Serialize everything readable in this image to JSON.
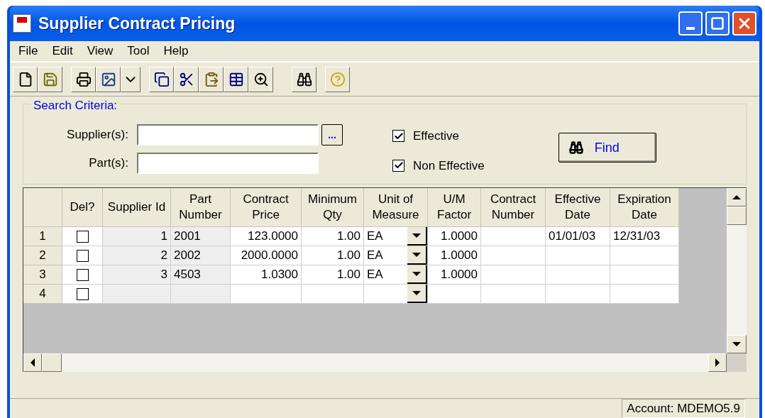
{
  "window": {
    "title": "Supplier Contract Pricing"
  },
  "menu": [
    {
      "label": "File"
    },
    {
      "label": "Edit"
    },
    {
      "label": "View"
    },
    {
      "label": "Tool"
    },
    {
      "label": "Help"
    }
  ],
  "search": {
    "legend": "Search Criteria:",
    "supplier_label": "Supplier(s):",
    "browse": "...",
    "part_label": "Part(s):",
    "checkboxes": [
      {
        "label": "Effective",
        "checked": true
      },
      {
        "label": "Non Effective",
        "checked": true
      }
    ],
    "find_button": "Find"
  },
  "table": {
    "columns": [
      {
        "label": "Del?",
        "kind": "checkbox"
      },
      {
        "label": "Supplier Id",
        "kind": "readonly-number"
      },
      {
        "label": "Part Number",
        "kind": "readonly-text"
      },
      {
        "label": "Contract Price",
        "kind": "number"
      },
      {
        "label": "Minimum Qty",
        "kind": "number"
      },
      {
        "label": "Unit of Measure",
        "kind": "dropdown"
      },
      {
        "label": "U/M Factor",
        "kind": "number"
      },
      {
        "label": "Contract Number",
        "kind": "text"
      },
      {
        "label": "Effective Date",
        "kind": "text"
      },
      {
        "label": "Expiration Date",
        "kind": "text"
      }
    ],
    "rows": [
      {
        "number": "1",
        "del": false,
        "cells": [
          "",
          "1",
          "2001",
          "123.0000",
          "1.00",
          "EA",
          "1.0000",
          "",
          "01/01/03",
          "12/31/03"
        ]
      },
      {
        "number": "2",
        "del": false,
        "cells": [
          "",
          "2",
          "2002",
          "2000.0000",
          "1.00",
          "EA",
          "1.0000",
          "",
          "",
          ""
        ]
      },
      {
        "number": "3",
        "del": false,
        "cells": [
          "",
          "3",
          "4503",
          "1.0300",
          "1.00",
          "EA",
          "1.0000",
          "",
          "",
          ""
        ]
      },
      {
        "number": "4",
        "del": false,
        "cells": [
          "",
          "",
          "",
          "",
          "",
          "",
          "",
          "",
          "",
          ""
        ]
      }
    ]
  },
  "status_bar": {
    "account": "Account: MDEMO5.9"
  }
}
